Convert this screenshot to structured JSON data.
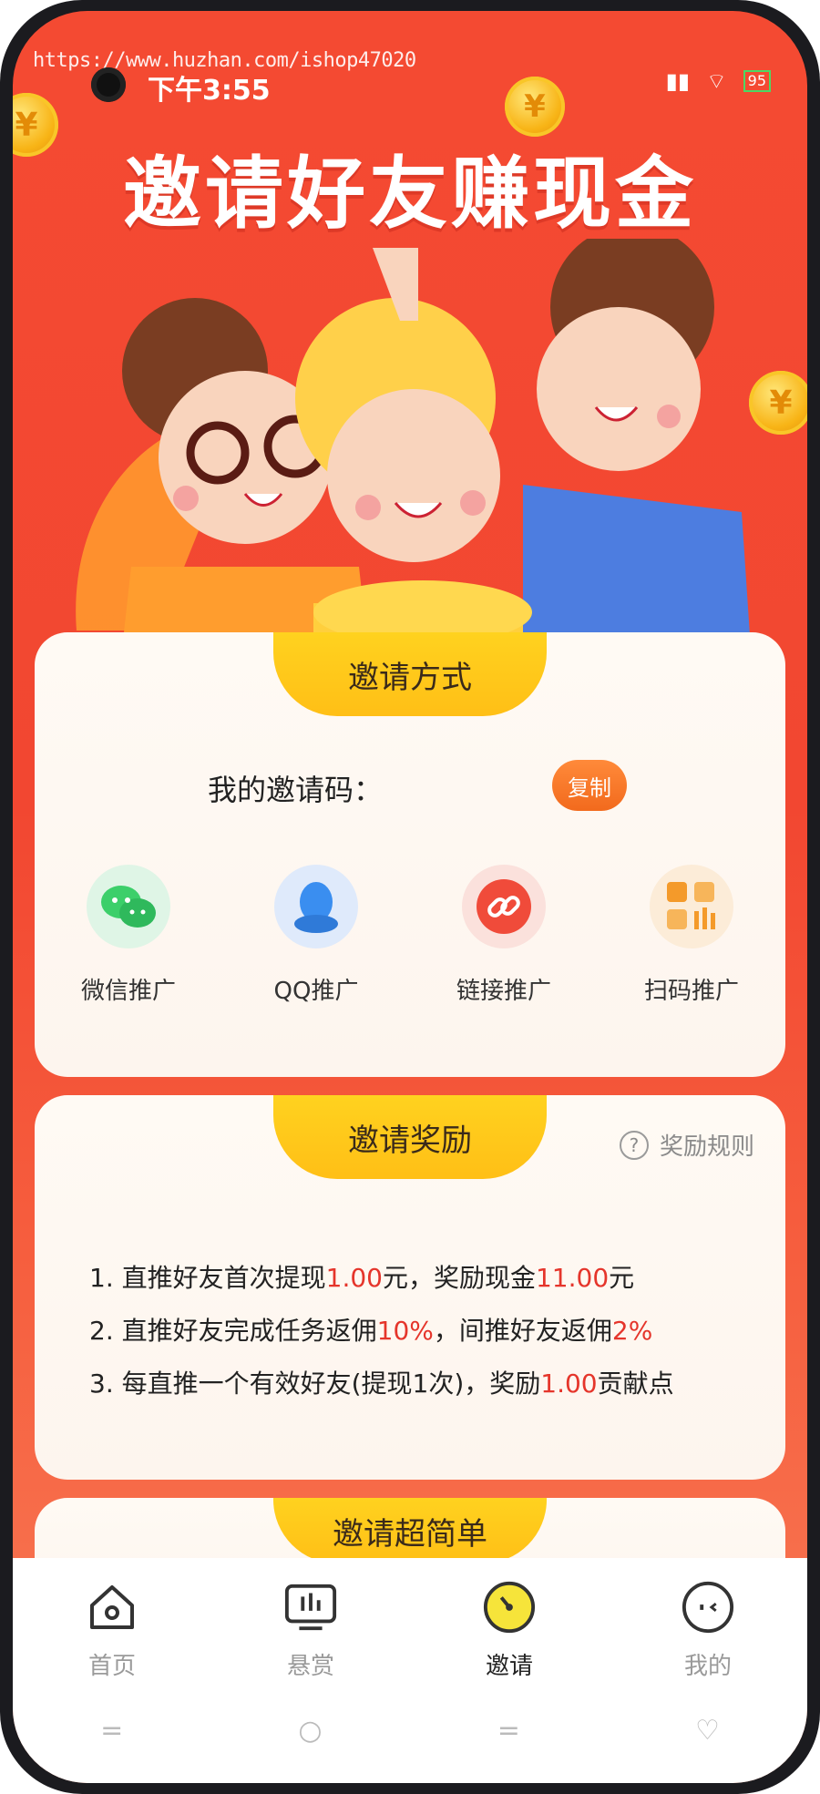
{
  "status": {
    "watermark": "https://www.huzhan.com/ishop47020",
    "time": "下午3:55",
    "battery": "95"
  },
  "hero": {
    "title": "邀请好友赚现金",
    "coin_symbol": "¥"
  },
  "invite_methods": {
    "tab_label": "邀请方式",
    "code_label": "我的邀请码：",
    "copy_button": "复制",
    "share_items": [
      {
        "label": "微信推广",
        "icon": "wechat-icon",
        "color": "#3ccf6a"
      },
      {
        "label": "QQ推广",
        "icon": "qq-icon",
        "color": "#3a8ef0"
      },
      {
        "label": "链接推广",
        "icon": "link-icon",
        "color": "#f04b3a"
      },
      {
        "label": "扫码推广",
        "icon": "qr-scan-icon",
        "color": "#f49a2a"
      }
    ]
  },
  "rewards": {
    "tab_label": "邀请奖励",
    "help_label": "奖励规则",
    "rules": [
      {
        "pre": "1. 直推好友首次提现",
        "v1": "1.00",
        "mid": "元，奖励现金",
        "v2": "11.00",
        "post": "元"
      },
      {
        "pre": "2. 直推好友完成任务返佣",
        "v1": "10%",
        "mid": "，间推好友返佣",
        "v2": "2%",
        "post": ""
      },
      {
        "pre": "3. 每直推一个有效好友(提现1次)，奖励",
        "v1": "1.00",
        "mid": "贡献点",
        "v2": "",
        "post": ""
      }
    ]
  },
  "simple": {
    "tab_label": "邀请超简单"
  },
  "nav": {
    "items": [
      {
        "label": "首页",
        "icon": "home-icon",
        "active": false
      },
      {
        "label": "悬赏",
        "icon": "bounty-icon",
        "active": false
      },
      {
        "label": "邀请",
        "icon": "invite-icon",
        "active": true
      },
      {
        "label": "我的",
        "icon": "profile-icon",
        "active": false
      }
    ]
  },
  "colors": {
    "accent_red": "#e5352b",
    "tab_yellow": "#ffd21f",
    "background_red": "#f44a32"
  }
}
